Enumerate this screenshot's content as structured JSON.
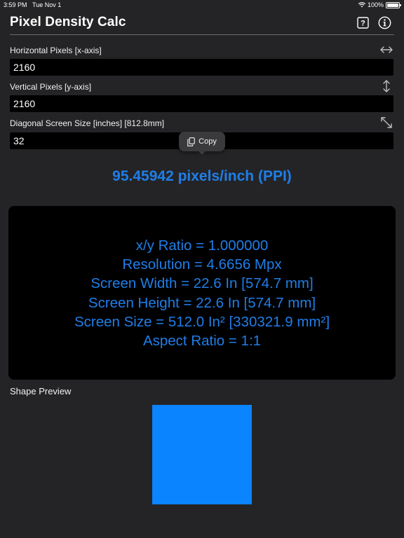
{
  "status_bar": {
    "time": "3:59 PM",
    "date": "Tue Nov 1",
    "battery": "100%"
  },
  "nav": {
    "title": "Pixel Density Calc",
    "help_icon": "question-mark-icon",
    "info_icon": "info-icon"
  },
  "fields": {
    "horizontal": {
      "label": "Horizontal Pixels  [x-axis]",
      "value": "2160",
      "icon": "horizontal-arrows-icon"
    },
    "vertical": {
      "label": "Vertical Pixels [y-axis]",
      "value": "2160",
      "icon": "vertical-arrows-icon"
    },
    "diagonal": {
      "label": "Diagonal Screen Size [inches] [812.8mm]",
      "value": "32",
      "icon": "diagonal-arrows-icon"
    }
  },
  "copy_popup": {
    "label": "Copy",
    "icon": "copy-icon"
  },
  "ppi_result": "95.45942 pixels/inch (PPI)",
  "results": [
    "x/y Ratio = 1.000000",
    "Resolution = 4.6656 Mpx",
    "Screen Width = 22.6 In [574.7 mm]",
    "Screen Height = 22.6 In [574.7 mm]",
    "Screen Size = 512.0 In² [330321.9 mm²]",
    "Aspect Ratio = 1:1"
  ],
  "shape_preview": {
    "label": "Shape Preview",
    "color": "#0a84ff"
  },
  "colors": {
    "background": "#242426",
    "accent": "#1f7ee8",
    "input_background": "#000000"
  }
}
